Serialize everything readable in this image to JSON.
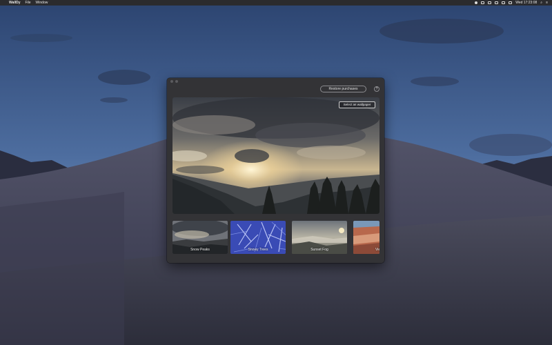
{
  "menubar": {
    "app_name": "WallDy",
    "menus": [
      "File",
      "Window"
    ],
    "clock": "Wed 17:23:08",
    "status_icons": [
      "apple-icon",
      "wifi-icon",
      "display-icon",
      "volume-icon",
      "keyboard-icon",
      "battery-icon",
      "search-icon",
      "notification-icon"
    ]
  },
  "window": {
    "restore_label": "Restore purchases",
    "help_label": "?",
    "preview": {
      "select_label": "Select as wallpaper"
    },
    "thumbnails": [
      {
        "label": "Snow Peaks"
      },
      {
        "label": "Snowy Trees"
      },
      {
        "label": "Sunset Fog"
      },
      {
        "label": "Vie"
      }
    ]
  },
  "colors": {
    "window_bg": "#333336",
    "menubar_bg": "#2b2b2e",
    "desktop_sky": "#4a6a9a",
    "dune": "#3b3c4c"
  }
}
